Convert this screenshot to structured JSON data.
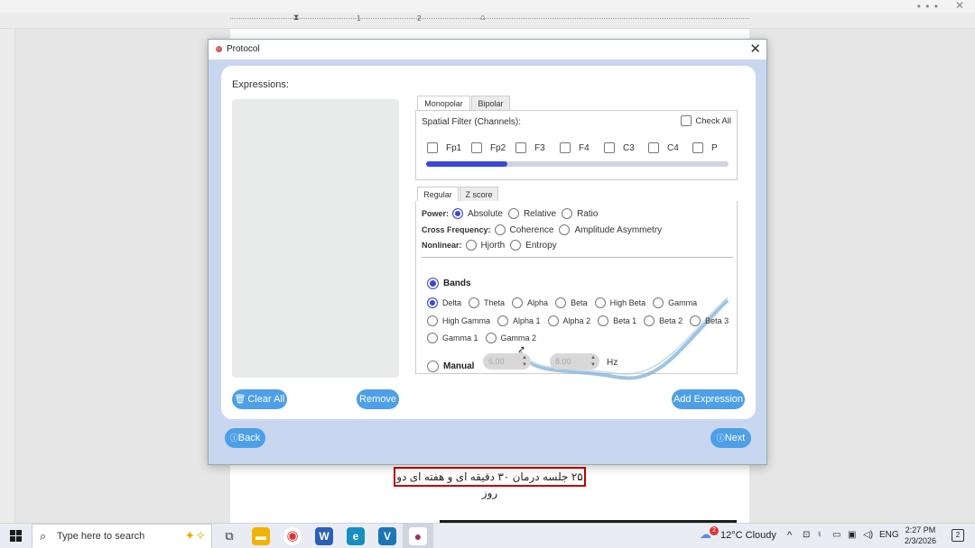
{
  "window": {
    "title": "Protocol",
    "close": "✕"
  },
  "ruler": {
    "marks": [
      "1",
      "2"
    ]
  },
  "document_text": "۲۵ جلسه درمان ۳۰ دقیقه ای و هفته ای دو روز",
  "expressions": {
    "label": "Expressions:",
    "clear_all": "Clear All",
    "remove": "Remove",
    "add_expression": "Add Expression"
  },
  "montage_tabs": [
    "Monopolar",
    "Bipolar"
  ],
  "spatial_filter": {
    "label": "Spatial Filter (Channels):",
    "check_all": "Check All",
    "channels": [
      "Fp1",
      "Fp2",
      "F3",
      "F4",
      "C3",
      "C4",
      "P"
    ],
    "scroll_fraction": 0.27
  },
  "score_tabs": [
    "Regular",
    "Z score"
  ],
  "power": {
    "label": "Power:",
    "options": [
      "Absolute",
      "Relative",
      "Ratio"
    ],
    "selected": "Absolute"
  },
  "cross_frequency": {
    "label": "Cross Frequency:",
    "options": [
      "Coherence",
      "Amplitude Asymmetry"
    ]
  },
  "nonlinear": {
    "label": "Nonlinear:",
    "options": [
      "Hjorth",
      "Entropy"
    ]
  },
  "bands": {
    "label": "Bands",
    "row1": [
      "Delta",
      "Theta",
      "Alpha",
      "Beta",
      "High Beta",
      "Gamma"
    ],
    "row2": [
      "High Gamma",
      "Alpha 1",
      "Alpha 2",
      "Beta 1",
      "Beta 2",
      "Beta 3"
    ],
    "row3": [
      "Gamma 1",
      "Gamma 2"
    ],
    "selected": "Delta"
  },
  "manual": {
    "label": "Manual",
    "from": "6.00",
    "to": "8.00",
    "unit": "Hz"
  },
  "nav": {
    "back": "Back",
    "next": "Next"
  },
  "taskbar": {
    "search_placeholder": "Type here to search",
    "weather": "12°C  Cloudy",
    "weather_badge": "2",
    "language": "ENG",
    "time": "2:27 PM",
    "date": "2/3/2026",
    "notifications": "2"
  },
  "colors": {
    "accent": "#4d9fe8",
    "selected": "#3a46d8",
    "dialog_bg": "#c8d7ef",
    "highlight_box": "#c00000"
  }
}
